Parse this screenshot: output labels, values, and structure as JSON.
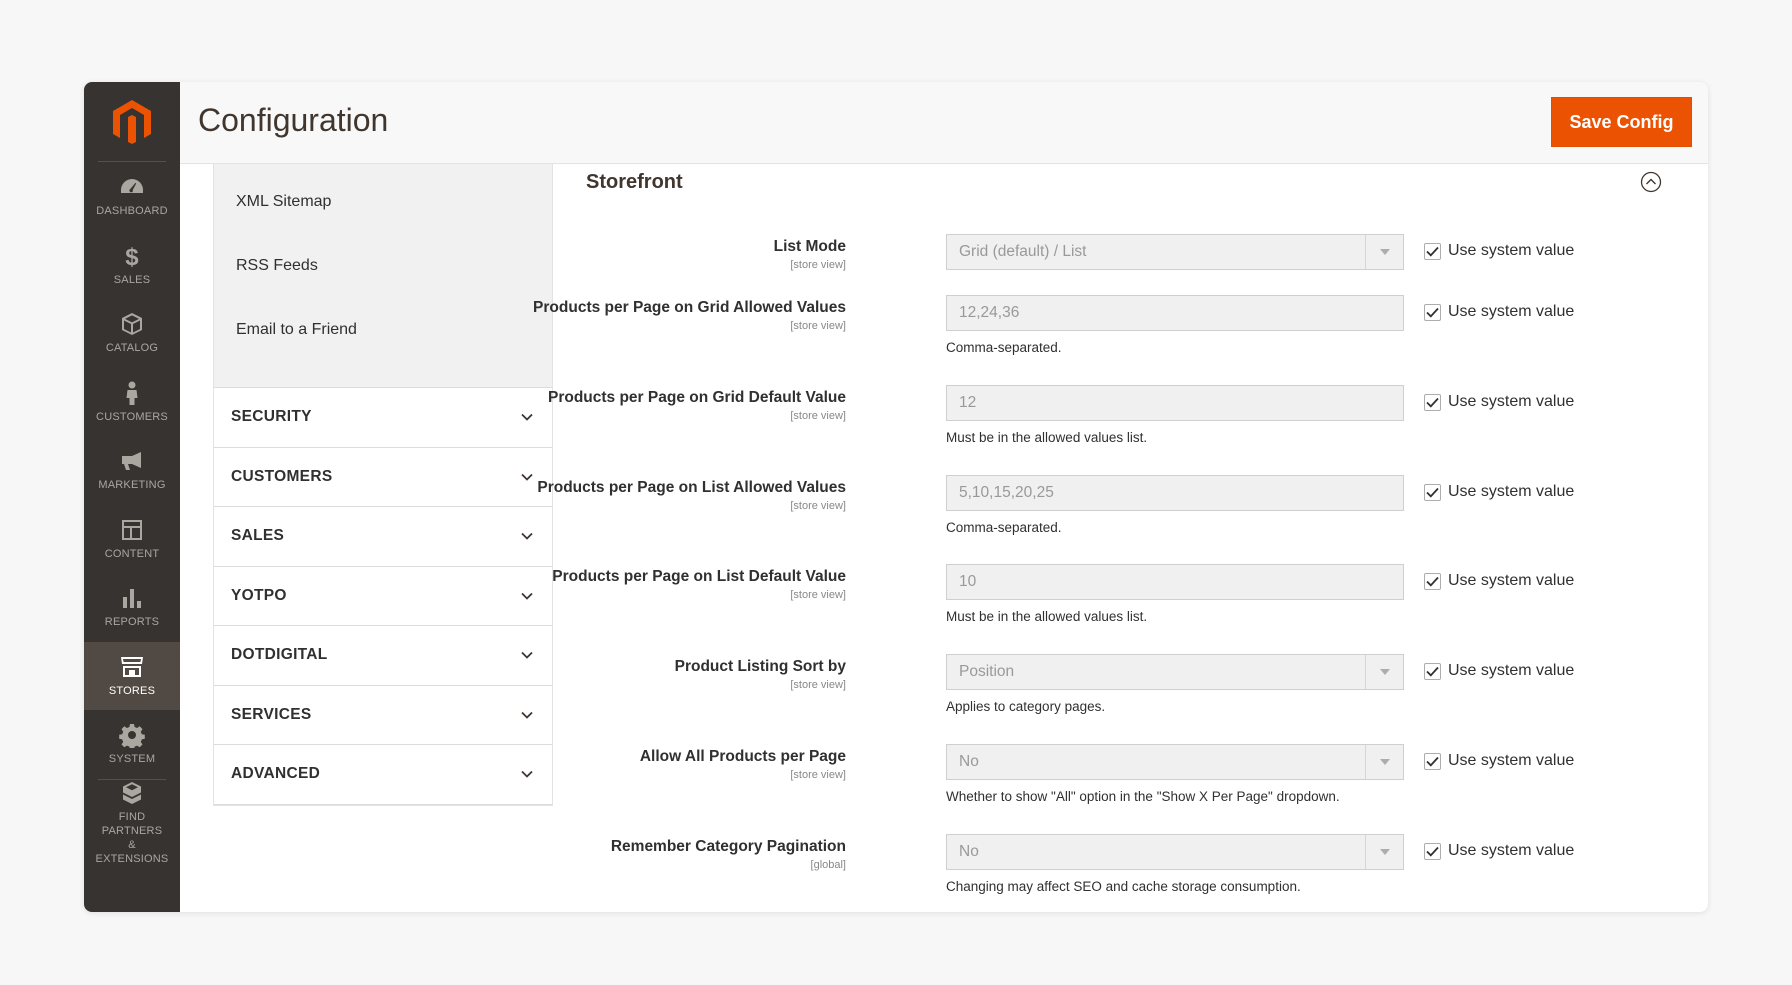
{
  "nav": {
    "items": [
      {
        "label": "DASHBOARD",
        "icon": "dashboard-icon"
      },
      {
        "label": "SALES",
        "icon": "dollar-icon"
      },
      {
        "label": "CATALOG",
        "icon": "cube-icon"
      },
      {
        "label": "CUSTOMERS",
        "icon": "person-icon"
      },
      {
        "label": "MARKETING",
        "icon": "megaphone-icon"
      },
      {
        "label": "CONTENT",
        "icon": "layout-icon"
      },
      {
        "label": "REPORTS",
        "icon": "bar-chart-icon"
      },
      {
        "label": "STORES",
        "icon": "storefront-icon",
        "active": true
      },
      {
        "label": "SYSTEM",
        "icon": "gear-icon"
      }
    ],
    "partners_line1": "FIND PARTNERS",
    "partners_line2": "& EXTENSIONS"
  },
  "header": {
    "title": "Configuration",
    "save_label": "Save Config"
  },
  "tabs": {
    "sub_items": [
      "XML Sitemap",
      "RSS Feeds",
      "Email to a Friend"
    ],
    "groups": [
      "SECURITY",
      "CUSTOMERS",
      "SALES",
      "YOTPO",
      "DOTDIGITAL",
      "SERVICES",
      "ADVANCED"
    ]
  },
  "section": {
    "title": "Storefront",
    "use_system_label": "Use system value",
    "fields": [
      {
        "label": "List Mode",
        "scope": "[store view]",
        "type": "select",
        "value": "Grid (default) / List",
        "note": "",
        "use_system": true
      },
      {
        "label": "Products per Page on Grid Allowed Values",
        "scope": "[store view]",
        "type": "text",
        "value": "12,24,36",
        "note": "Comma-separated.",
        "use_system": true
      },
      {
        "label": "Products per Page on Grid Default Value",
        "scope": "[store view]",
        "type": "text",
        "value": "12",
        "note": "Must be in the allowed values list.",
        "use_system": true
      },
      {
        "label": "Products per Page on List Allowed Values",
        "scope": "[store view]",
        "type": "text",
        "value": "5,10,15,20,25",
        "note": "Comma-separated.",
        "use_system": true
      },
      {
        "label": "Products per Page on List Default Value",
        "scope": "[store view]",
        "type": "text",
        "value": "10",
        "note": "Must be in the allowed values list.",
        "use_system": true
      },
      {
        "label": "Product Listing Sort by",
        "scope": "[store view]",
        "type": "select",
        "value": "Position",
        "note": "Applies to category pages.",
        "use_system": true
      },
      {
        "label": "Allow All Products per Page",
        "scope": "[store view]",
        "type": "select",
        "value": "No",
        "note": "Whether to show \"All\" option in the \"Show X Per Page\" dropdown.",
        "use_system": true
      },
      {
        "label": "Remember Category Pagination",
        "scope": "[global]",
        "type": "select",
        "value": "No",
        "note": "Changing may affect SEO and cache storage consumption.",
        "use_system": true
      }
    ]
  },
  "colors": {
    "accent": "#eb5202",
    "nav_bg": "#373330",
    "nav_active": "#514943"
  }
}
